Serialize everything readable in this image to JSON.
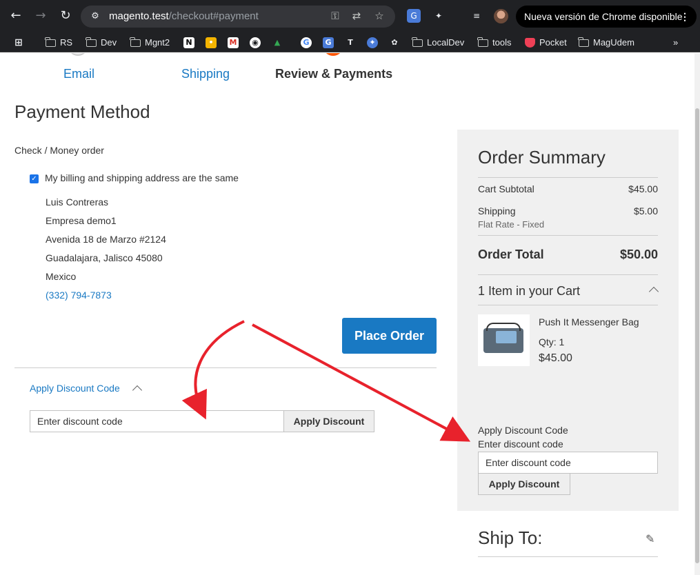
{
  "browser": {
    "url_host": "magento.test",
    "url_path": "/checkout#payment",
    "update_banner": "Nueva versión de Chrome disponible",
    "bookmarks": [
      "RS",
      "Dev",
      "Mgnt2",
      "LocalDev",
      "tools",
      "Pocket",
      "MagUdem"
    ],
    "more_bookmarks": "»"
  },
  "steps": [
    {
      "label": "Email"
    },
    {
      "label": "Shipping"
    },
    {
      "label": "Review & Payments"
    }
  ],
  "payment": {
    "title": "Payment Method",
    "method": "Check / Money order",
    "same_address_label": "My billing and shipping address are the same",
    "same_address_checked": true,
    "address": {
      "name": "Luis Contreras",
      "company": "Empresa demo1",
      "street": "Avenida 18 de Marzo #2124",
      "city_line": "Guadalajara, Jalisco 45080",
      "country": "Mexico",
      "phone": "(332) 794-7873"
    },
    "place_order": "Place Order",
    "discount": {
      "title": "Apply Discount Code",
      "placeholder": "Enter discount code",
      "button": "Apply Discount"
    }
  },
  "summary": {
    "title": "Order Summary",
    "subtotal_label": "Cart Subtotal",
    "subtotal_value": "$45.00",
    "shipping_label": "Shipping",
    "shipping_value": "$5.00",
    "shipping_method": "Flat Rate - Fixed",
    "total_label": "Order Total",
    "total_value": "$50.00",
    "items_header": "1 Item in your Cart",
    "item": {
      "name": "Push It Messenger Bag",
      "qty": "Qty: 1",
      "price": "$45.00"
    },
    "discount": {
      "title": "Apply Discount Code",
      "label": "Enter discount code",
      "placeholder": "Enter discount code",
      "button": "Apply Discount"
    }
  },
  "ship_to": {
    "title": "Ship To:"
  },
  "colors": {
    "accent": "#1979c3",
    "annotation_arrow": "#e8222c",
    "summary_bg": "#f0f0f0"
  }
}
